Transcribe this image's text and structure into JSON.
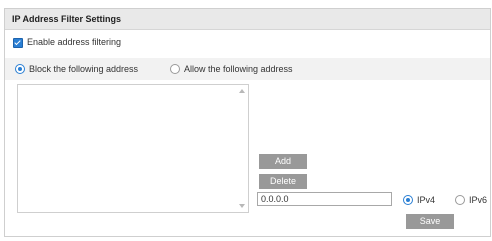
{
  "panel": {
    "title": "IP Address Filter Settings"
  },
  "enable": {
    "label": "Enable address filtering",
    "checked": true
  },
  "mode": {
    "options": [
      {
        "label": "Block the following address",
        "selected": true
      },
      {
        "label": "Allow the following address",
        "selected": false
      }
    ]
  },
  "address_list": {
    "items": []
  },
  "buttons": {
    "add": "Add",
    "delete": "Delete",
    "save": "Save"
  },
  "ip_input": {
    "value": "0.0.0.0"
  },
  "ip_version": {
    "options": [
      {
        "label": "IPv4",
        "selected": true
      },
      {
        "label": "IPv6",
        "selected": false
      }
    ]
  },
  "colors": {
    "accent": "#2a7fd4",
    "button": "#999999",
    "header_bg": "#e9e9e9"
  }
}
